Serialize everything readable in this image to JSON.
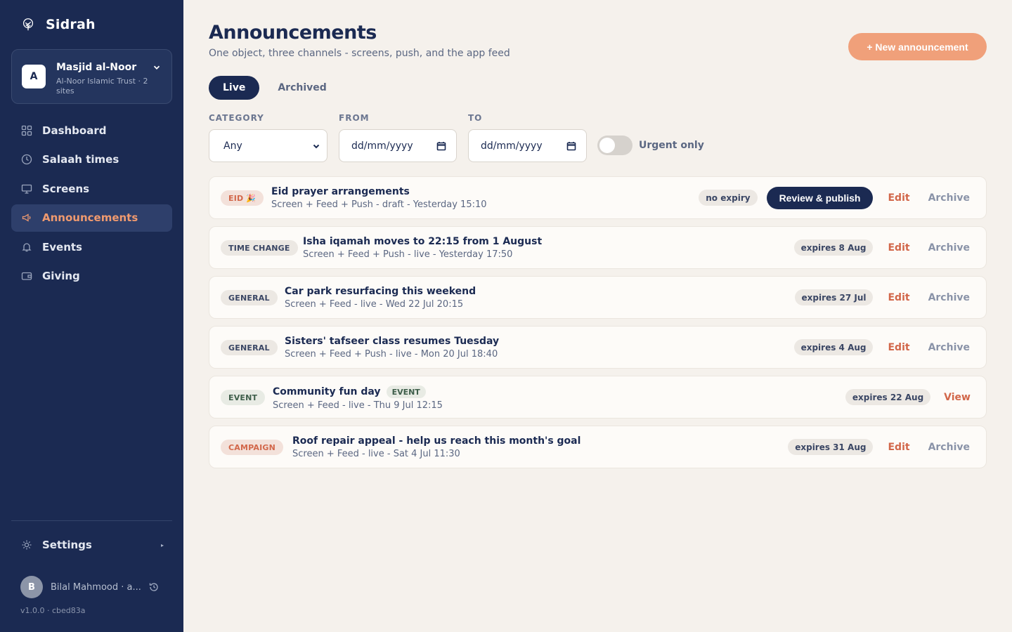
{
  "brand": {
    "name": "Sidrah",
    "logo_icon": "tree-logo-icon"
  },
  "org": {
    "avatar_letter": "A",
    "name": "Masjid al-Noor",
    "subtitle": "Al-Noor Islamic Trust · 2 sites"
  },
  "nav": {
    "items": [
      {
        "label": "Dashboard",
        "icon": "grid-icon"
      },
      {
        "label": "Salaah times",
        "icon": "clock-icon"
      },
      {
        "label": "Screens",
        "icon": "monitor-icon"
      },
      {
        "label": "Announcements",
        "icon": "megaphone-icon",
        "active": true
      },
      {
        "label": "Events",
        "icon": "bell-icon"
      },
      {
        "label": "Giving",
        "icon": "wallet-icon"
      }
    ],
    "settings_label": "Settings",
    "settings_caret": "▸"
  },
  "user": {
    "avatar_letter": "B",
    "name": "Bilal Mahmood · a...",
    "version": "v1.0.0 · cbed83a"
  },
  "header": {
    "title": "Announcements",
    "subtitle": "One object, three channels - screens, push, and the app feed",
    "new_button": "+ New announcement"
  },
  "tabs": {
    "live": "Live",
    "archived": "Archived"
  },
  "filters": {
    "category_label": "CATEGORY",
    "category_value": "Any",
    "from_label": "FROM",
    "from_placeholder": "dd/mm/yyyy",
    "to_label": "TO",
    "to_placeholder": "dd/mm/yyyy",
    "urgent_label": "Urgent only",
    "urgent_on": false
  },
  "announcements": [
    {
      "category": "EID 🎉",
      "title": "Eid prayer arrangements",
      "meta": "Screen + Feed + Push - draft - Yesterday 15:10",
      "expiry": "no expiry",
      "publish": "Review & publish",
      "edit": "Edit",
      "archive": "Archive"
    },
    {
      "category": "TIME CHANGE",
      "title": "Isha iqamah moves to 22:15 from 1 August",
      "meta": "Screen + Feed + Push - live - Yesterday 17:50",
      "expiry": "expires 8 Aug",
      "edit": "Edit",
      "archive": "Archive"
    },
    {
      "category": "GENERAL",
      "title": "Car park resurfacing this weekend",
      "meta": "Screen + Feed - live - Wed 22 Jul 20:15",
      "expiry": "expires 27 Jul",
      "edit": "Edit",
      "archive": "Archive"
    },
    {
      "category": "GENERAL",
      "title": "Sisters' tafseer class resumes Tuesday",
      "meta": "Screen + Feed + Push - live - Mon 20 Jul 18:40",
      "expiry": "expires 4 Aug",
      "edit": "Edit",
      "archive": "Archive"
    },
    {
      "category": "EVENT",
      "title": "Community fun day",
      "tag": "EVENT",
      "meta": "Screen + Feed - live - Thu 9 Jul 12:15",
      "expiry": "expires 22 Aug",
      "view": "View"
    },
    {
      "category": "CAMPAIGN",
      "title": "Roof repair appeal - help us reach this month's goal",
      "meta": "Screen + Feed - live - Sat 4 Jul 11:30",
      "expiry": "expires 31 Aug",
      "edit": "Edit",
      "archive": "Archive"
    }
  ],
  "colors": {
    "sidebar": "#1b2a52",
    "accent": "#f0a07a",
    "link": "#d2674a",
    "background": "#f5f1ec"
  }
}
